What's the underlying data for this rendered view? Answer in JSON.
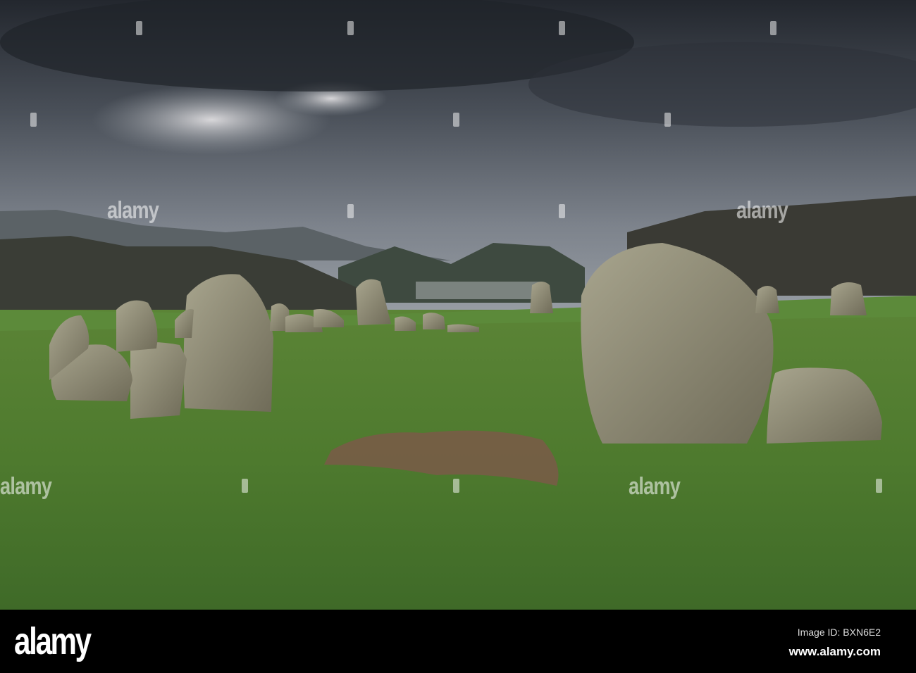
{
  "photo": {
    "subject": "stone circle on grassy field under stormy sky with mountains",
    "colors": {
      "sky_dark": "#2a2f37",
      "sky_light": "#8a9099",
      "grass": "#4f7a2c",
      "stone": "#8e8a72",
      "mountain": "#3b463b"
    }
  },
  "watermark": {
    "text": "alamy"
  },
  "footer": {
    "logo": "alamy",
    "image_id": "Image ID: BXN6E2",
    "website": "www.alamy.com"
  }
}
